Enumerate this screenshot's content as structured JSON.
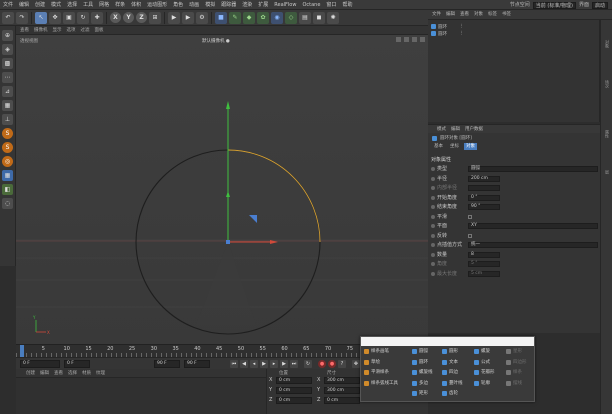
{
  "menubar": {
    "items": [
      "文件",
      "编辑",
      "创建",
      "模式",
      "选择",
      "工具",
      "网格",
      "样条",
      "体积",
      "运动图形",
      "角色",
      "动画",
      "模拟",
      "跟踪器",
      "渲染",
      "扩展",
      "RealFlow",
      "Octane",
      "窗口",
      "帮助"
    ],
    "right_label": "节点空间",
    "right_value": "当前 (标准/物理)",
    "layout_label": "界面",
    "layout_value": "启动"
  },
  "viewport": {
    "menu": [
      "查看",
      "摄像机",
      "显示",
      "选项",
      "过滤",
      "面板"
    ],
    "label": "透视视图",
    "camera": "默认摄像机 ●"
  },
  "timeline": {
    "ticks": [
      "0",
      "5",
      "10",
      "15",
      "20",
      "25",
      "30",
      "35",
      "40",
      "45",
      "50",
      "55",
      "60",
      "65",
      "70",
      "75",
      "80",
      "85",
      "90"
    ],
    "current_frame": "0 F",
    "start": "0 F",
    "end": "90 F",
    "max": "90 F"
  },
  "material": {
    "menu": [
      "创建",
      "编辑",
      "查看",
      "选择",
      "材质",
      "纹理"
    ]
  },
  "coords": {
    "pos_header": "位置",
    "size_header": "尺寸",
    "rows": [
      {
        "axis": "X",
        "pos": "0 cm",
        "size_axis": "X",
        "size": "300 cm"
      },
      {
        "axis": "Y",
        "pos": "0 cm",
        "size_axis": "Y",
        "size": "300 cm"
      },
      {
        "axis": "Z",
        "pos": "0 cm",
        "size_axis": "Z",
        "size": "0 cm"
      }
    ],
    "extra": [
      "H",
      "0 °",
      "P",
      "0 °"
    ]
  },
  "objects": {
    "menu": [
      "文件",
      "编辑",
      "查看",
      "对象",
      "标签",
      "书签"
    ],
    "items": [
      {
        "name": "圆环"
      },
      {
        "name": "圆环"
      }
    ]
  },
  "attributes": {
    "menu": [
      "模式",
      "编辑",
      "用户数据"
    ],
    "object_title": "圆环对象 [圆环]",
    "tabs": [
      "基本",
      "坐标",
      "对象"
    ],
    "section": "对象属性",
    "rows": [
      {
        "label": "类型",
        "value": "圆弧",
        "kind": "dd"
      },
      {
        "label": "半径",
        "value": "200 cm",
        "kind": "num"
      },
      {
        "label": "内部半径",
        "value": "",
        "kind": "num",
        "dim": true
      },
      {
        "label": "开始角度",
        "value": "0 °",
        "kind": "num"
      },
      {
        "label": "结束角度",
        "value": "90 °",
        "kind": "num"
      },
      {
        "label": "平滑",
        "value": "",
        "kind": "check"
      },
      {
        "label": "平面",
        "value": "XY",
        "kind": "dd"
      },
      {
        "label": "反转",
        "value": "",
        "kind": "check"
      },
      {
        "label": "点插值方式",
        "value": "统一",
        "kind": "dd"
      },
      {
        "label": "数量",
        "value": "8",
        "kind": "num"
      },
      {
        "label": "角度",
        "value": "5 °",
        "kind": "num",
        "dim": true
      },
      {
        "label": "最大长度",
        "value": "5 cm",
        "kind": "num",
        "dim": true
      }
    ]
  },
  "context_menu": {
    "col1": [
      "样条画笔",
      "草绘",
      "平滑样条",
      "样条弧线工具"
    ],
    "col2": [
      "圆弧",
      "圆环",
      "螺旋线",
      "多边",
      "矩形"
    ],
    "col3": [
      "圆形",
      "文本",
      "四边",
      "蔓叶线",
      "齿轮"
    ],
    "col4": [
      "螺旋",
      "公式",
      "花瓣形",
      "轮廓"
    ],
    "col5": [
      "星形",
      "四边形",
      "样条",
      "摆线"
    ]
  }
}
